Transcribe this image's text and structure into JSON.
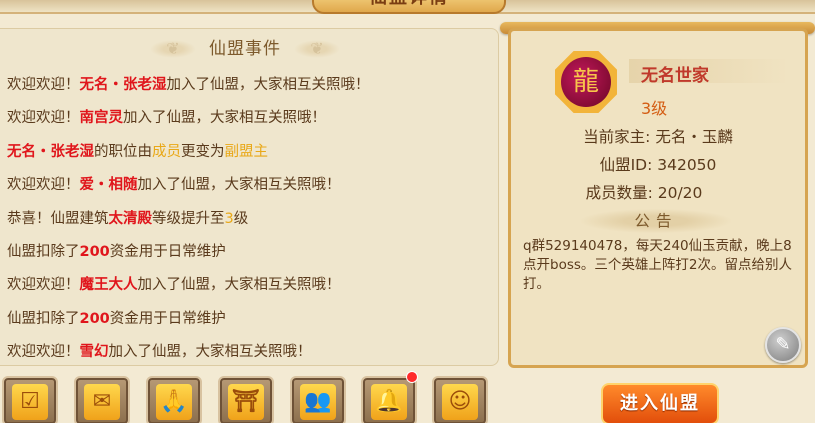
{
  "title": "仙盟详情",
  "events": {
    "header": "仙盟事件",
    "rows": [
      [
        {
          "t": "欢迎欢迎！",
          "c": ""
        },
        {
          "t": "无名・张老湿",
          "c": "red"
        },
        {
          "t": "加入了仙盟，大家相互关照哦！",
          "c": ""
        }
      ],
      [
        {
          "t": "欢迎欢迎！",
          "c": ""
        },
        {
          "t": "南宫灵",
          "c": "red"
        },
        {
          "t": "加入了仙盟，大家相互关照哦！",
          "c": ""
        }
      ],
      [
        {
          "t": "无名・张老湿",
          "c": "red"
        },
        {
          "t": "的职位由",
          "c": ""
        },
        {
          "t": "成员",
          "c": "gold"
        },
        {
          "t": "更变为",
          "c": ""
        },
        {
          "t": "副盟主",
          "c": "gold"
        }
      ],
      [
        {
          "t": "欢迎欢迎！",
          "c": ""
        },
        {
          "t": "爱・相随",
          "c": "red"
        },
        {
          "t": "加入了仙盟，大家相互关照哦！",
          "c": ""
        }
      ],
      [
        {
          "t": "恭喜！仙盟建筑",
          "c": ""
        },
        {
          "t": "太清殿",
          "c": "red"
        },
        {
          "t": "等级提升至",
          "c": ""
        },
        {
          "t": "3",
          "c": "gold"
        },
        {
          "t": "级",
          "c": ""
        }
      ],
      [
        {
          "t": "仙盟扣除了",
          "c": ""
        },
        {
          "t": "200",
          "c": "red"
        },
        {
          "t": "资金用于日常维护",
          "c": ""
        }
      ],
      [
        {
          "t": "欢迎欢迎！",
          "c": ""
        },
        {
          "t": "魔王大人",
          "c": "red"
        },
        {
          "t": "加入了仙盟，大家相互关照哦！",
          "c": ""
        }
      ],
      [
        {
          "t": "仙盟扣除了",
          "c": ""
        },
        {
          "t": "200",
          "c": "red"
        },
        {
          "t": "资金用于日常维护",
          "c": ""
        }
      ],
      [
        {
          "t": "欢迎欢迎！",
          "c": ""
        },
        {
          "t": "雪幻",
          "c": "red"
        },
        {
          "t": "加入了仙盟，大家相互关照哦！",
          "c": ""
        }
      ]
    ]
  },
  "guild": {
    "name": "无名世家",
    "level": "3级",
    "leader": "当前家主: 无名・玉麟",
    "id": "仙盟ID: 342050",
    "members": "成员数量: 20/20",
    "notice_header": "公告",
    "notice": "q群529140478，每天240仙玉贡献，晚上8点开boss。三个英雄上阵打2次。留点给别人打。"
  },
  "actions": {
    "icons": [
      {
        "name": "checkin-icon",
        "glyph": "☑"
      },
      {
        "name": "envelope-icon",
        "glyph": "✉"
      },
      {
        "name": "pray-hands-icon",
        "glyph": "🙏"
      },
      {
        "name": "shrine-icon",
        "glyph": "⛩"
      },
      {
        "name": "members-icon",
        "glyph": "👥"
      },
      {
        "name": "bell-icon",
        "glyph": "🔔"
      },
      {
        "name": "person-icon",
        "glyph": "☺"
      }
    ],
    "enter_label": "进入仙盟"
  }
}
